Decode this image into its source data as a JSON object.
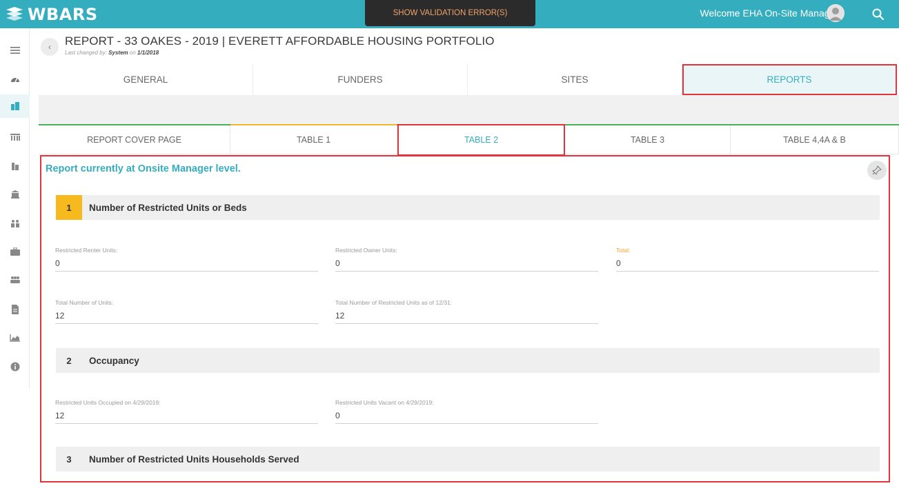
{
  "app": {
    "logo_text": "WBARS",
    "validation_button": "SHOW VALIDATION ERROR(S)",
    "welcome_text": "Welcome EHA On-Site Manager"
  },
  "sidebar": {
    "items": [
      "menu-icon",
      "dashboard-icon",
      "properties-icon",
      "portfolio-icon",
      "buildings-icon",
      "bank-icon",
      "users-group-icon",
      "briefcase-icon",
      "people-icon",
      "document-icon",
      "chart-icon",
      "info-icon"
    ]
  },
  "header": {
    "title": "REPORT - 33 OAKES - 2019 | EVERETT AFFORDABLE HOUSING PORTFOLIO",
    "last_changed_prefix": "Last changed by:",
    "last_changed_user": "System",
    "last_changed_on": "on",
    "last_changed_date": "1/1/2018"
  },
  "main_tabs": [
    {
      "label": "GENERAL"
    },
    {
      "label": "FUNDERS"
    },
    {
      "label": "SITES"
    },
    {
      "label": "REPORTS",
      "active": true
    }
  ],
  "sub_tabs": [
    {
      "label": "REPORT COVER PAGE"
    },
    {
      "label": "TABLE 1"
    },
    {
      "label": "TABLE 2",
      "active": true
    },
    {
      "label": "TABLE 3"
    },
    {
      "label": "TABLE 4,4A & B"
    }
  ],
  "content": {
    "level_text": "Report currently at Onsite Manager level.",
    "sections": [
      {
        "number": "1",
        "title": "Number of Restricted Units or Beds",
        "fields": [
          {
            "label": "Restricted Renter Units:",
            "value": "0"
          },
          {
            "label": "Restricted Owner Units:",
            "value": "0"
          },
          {
            "label": "Total:",
            "value": "0"
          },
          {
            "label": "Total Number of Units:",
            "value": "12"
          },
          {
            "label": "Total Number of Restricted Units as of 12/31:",
            "value": "12"
          }
        ]
      },
      {
        "number": "2",
        "title": "Occupancy",
        "fields": [
          {
            "label": "Restricted Units Occupied on 4/29/2019:",
            "value": "12"
          },
          {
            "label": "Restricted Units Vacant on 4/29/2019:",
            "value": "0"
          }
        ]
      },
      {
        "number": "3",
        "title": "Number of Restricted Units Households Served"
      }
    ]
  },
  "colors": {
    "accent": "#34aebf",
    "highlight_border": "#e2323c",
    "section_badge": "#f6b91e",
    "total_label": "#f2a42b",
    "validation_text": "#f2a46a"
  }
}
